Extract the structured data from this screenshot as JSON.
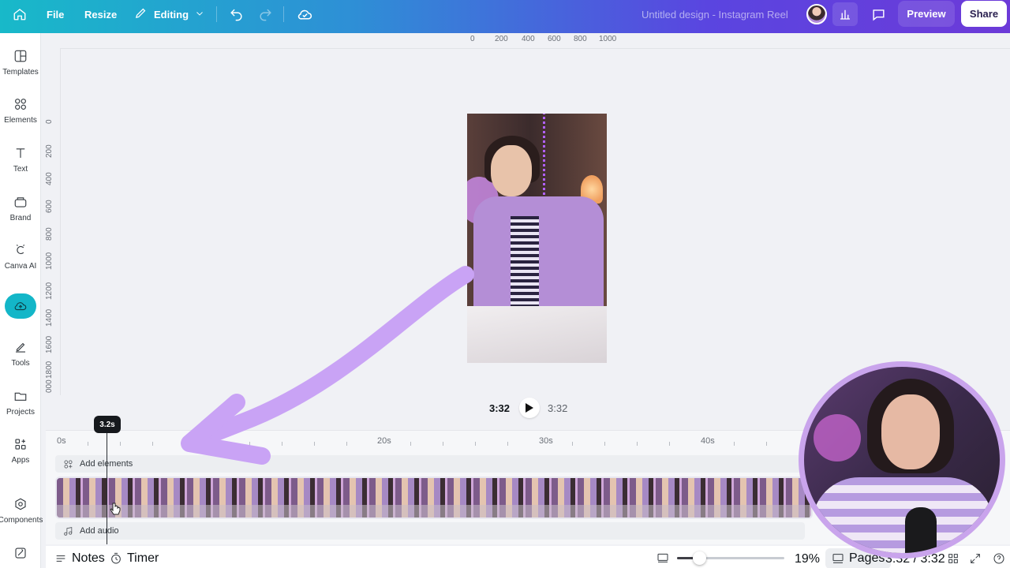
{
  "topbar": {
    "file_label": "File",
    "resize_label": "Resize",
    "mode_label": "Editing",
    "design_title": "Untitled design - Instagram Reel",
    "preview_label": "Preview",
    "share_label": "Share"
  },
  "sidebar": {
    "items": [
      {
        "label": "Templates",
        "icon": "templates-icon"
      },
      {
        "label": "Elements",
        "icon": "elements-icon"
      },
      {
        "label": "Text",
        "icon": "text-icon"
      },
      {
        "label": "Brand",
        "icon": "brand-icon"
      },
      {
        "label": "Canva AI",
        "icon": "canva-ai-icon"
      },
      {
        "label": "",
        "icon": "upload-icon"
      },
      {
        "label": "Tools",
        "icon": "tools-icon"
      },
      {
        "label": "Projects",
        "icon": "projects-icon"
      },
      {
        "label": "Apps",
        "icon": "apps-icon"
      },
      {
        "label": "Components",
        "icon": "components-icon"
      }
    ]
  },
  "rulers": {
    "top": [
      "0",
      "200",
      "400",
      "600",
      "800",
      "1000"
    ],
    "left": [
      "0",
      "200",
      "400",
      "600",
      "800",
      "1000",
      "1200",
      "1400",
      "1600",
      "1800",
      "000"
    ]
  },
  "player": {
    "current_time": "3:32",
    "total_time": "3:32"
  },
  "timeline": {
    "playhead_label": "3.2s",
    "ticks": [
      "0s",
      "20s",
      "30s",
      "40s"
    ],
    "add_elements_label": "Add elements",
    "add_audio_label": "Add audio"
  },
  "bottombar": {
    "notes_label": "Notes",
    "timer_label": "Timer",
    "zoom_value": "19%",
    "zoom_fraction": 0.19,
    "pages_label": "Pages",
    "page_counter": "3:32 / 3:32"
  },
  "colors": {
    "topbar_gradient_start": "#18b9c9",
    "topbar_gradient_end": "#6c3ad8",
    "arrow_annotation": "#c9a3f5",
    "upload_accent": "#13b6c8"
  }
}
